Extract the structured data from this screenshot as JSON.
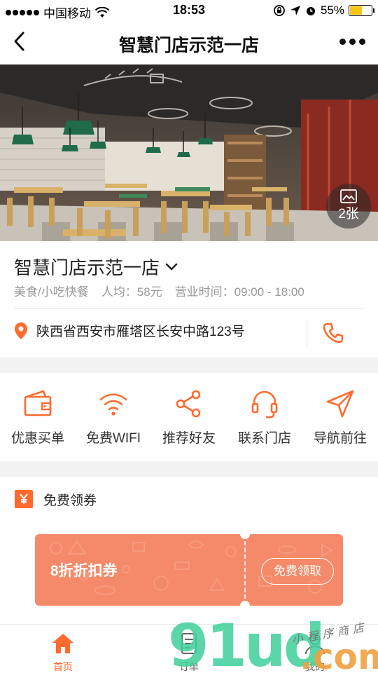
{
  "status_bar": {
    "carrier": "中国移动",
    "time": "18:53",
    "battery": "55%",
    "battery_level": 0.55
  },
  "navbar": {
    "title": "智慧门店示范一店"
  },
  "hero": {
    "photo_count": "2张"
  },
  "store": {
    "name": "智慧门店示范一店",
    "category": "美食/小吃快餐",
    "avg_price": "人均：58元",
    "hours": "营业时间：09:00 - 18:00",
    "address": "陕西省西安市雁塔区长安中路123号"
  },
  "actions": [
    {
      "label": "优惠买单",
      "icon": "wallet-icon"
    },
    {
      "label": "免费WIFI",
      "icon": "wifi-icon"
    },
    {
      "label": "推荐好友",
      "icon": "share-icon"
    },
    {
      "label": "联系门店",
      "icon": "headset-icon"
    },
    {
      "label": "导航前往",
      "icon": "navigation-icon"
    }
  ],
  "coupons": {
    "heading": "免费领券",
    "items": [
      {
        "title": "8折折扣券",
        "button": "免费领取"
      }
    ]
  },
  "tabbar": [
    {
      "label": "首页",
      "icon": "home-icon",
      "active": true
    },
    {
      "label": "订单",
      "icon": "order-icon",
      "active": false
    },
    {
      "label": "我的",
      "icon": "profile-icon",
      "active": false
    }
  ],
  "watermark": {
    "brand": "91ud",
    "suffix": ".com",
    "caption": "小程序商店"
  },
  "colors": {
    "accent": "#ff6a2e",
    "coupon": "#f48a6a",
    "watermark_green": "#3fcf9a"
  }
}
